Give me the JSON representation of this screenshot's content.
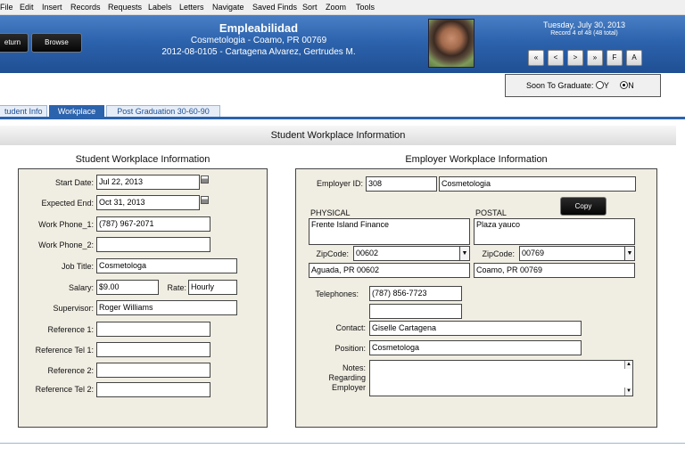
{
  "menu": [
    "File",
    "Edit",
    "Insert",
    "Records",
    "Requests",
    "Labels",
    "Letters",
    "Navigate",
    "Saved Finds",
    "Sort",
    "Zoom",
    "Tools"
  ],
  "header": {
    "return_label": "eturn",
    "browse_label": "Browse",
    "title": "Empleabilidad",
    "line1": "Cosmetologia  - Coamo, PR 00769",
    "line2": "2012-08-0105 - Cartagena Alvarez, Gertrudes M.",
    "date": "Tuesday, July 30, 2013",
    "record_info": "Record 4 of 48 (48 total)",
    "nav": [
      "«",
      "<",
      ">",
      "»",
      "F",
      "A"
    ]
  },
  "soon": {
    "label": "Soon To Graduate:",
    "yes": "Y",
    "no": "N",
    "selected": "N"
  },
  "tabs": [
    "tudent Info",
    "Workplace",
    "Post Graduation 30-60-90"
  ],
  "section_title": "Student Workplace Information",
  "student": {
    "title": "Student Workplace Information",
    "start_date": {
      "label": "Start Date:",
      "value": "Jul 22, 2013"
    },
    "expected_end": {
      "label": "Expected End:",
      "value": "Oct 31, 2013"
    },
    "work_phone_1": {
      "label": "Work Phone_1:",
      "value": "(787) 967-2071"
    },
    "work_phone_2": {
      "label": "Work Phone_2:",
      "value": ""
    },
    "job_title": {
      "label": "Job Title:",
      "value": "Cosmetologa"
    },
    "salary": {
      "label": "Salary:",
      "value": "$9.00"
    },
    "rate": {
      "label": "Rate:",
      "value": "Hourly"
    },
    "supervisor": {
      "label": "Supervisor:",
      "value": "Roger Williams"
    },
    "reference_1": {
      "label": "Reference 1:",
      "value": ""
    },
    "reference_tel_1": {
      "label": "Reference Tel 1:",
      "value": ""
    },
    "reference_2": {
      "label": "Reference 2:",
      "value": ""
    },
    "reference_tel_2": {
      "label": "Reference Tel 2:",
      "value": ""
    }
  },
  "employer": {
    "title": "Employer Workplace Information",
    "employer_id": {
      "label": "Employer ID:",
      "value": "308",
      "name": "Cosmetologia"
    },
    "copy_label": "Copy",
    "physical": {
      "label": "PHYSICAL",
      "address": "Frente Island Finance",
      "zip_label": "ZipCode:",
      "zip": "00602",
      "city": "Aguada, PR 00602"
    },
    "postal": {
      "label": "POSTAL",
      "address": "Plaza yauco",
      "zip_label": "ZipCode:",
      "zip": "00769",
      "city": "Coamo, PR 00769"
    },
    "telephones": {
      "label": "Telephones:",
      "values": [
        "(787) 856-7723",
        ""
      ]
    },
    "contact": {
      "label": "Contact:",
      "value": "Giselle Cartagena"
    },
    "position": {
      "label": "Position:",
      "value": "Cosmetologa"
    },
    "notes": {
      "label_lines": [
        "Notes:",
        "Regarding",
        "Employer"
      ],
      "value": ""
    }
  },
  "colors": {
    "header_blue": "#2c63ad",
    "panel_bg": "#f0ede2"
  }
}
